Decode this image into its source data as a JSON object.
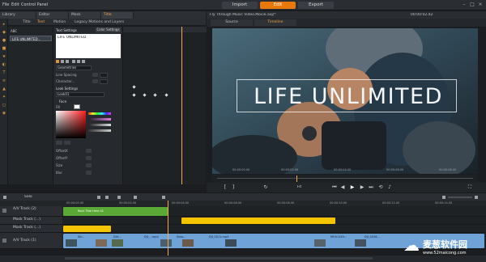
{
  "menu": {
    "items": [
      "File",
      "Edit",
      "Control Panel"
    ],
    "modes": [
      "Import",
      "Edit",
      "Export"
    ],
    "active_mode": "Edit"
  },
  "library_tabs": [
    "Library",
    "Editor",
    "Mask",
    "Title"
  ],
  "title_editor": {
    "subtabs": [
      "Title",
      "Text",
      "Motion",
      "Legacy Motions and Layers"
    ],
    "active_subtab": "Text",
    "layer_label": "LIFE UNLIMITED...",
    "text_settings_header": "Text Settings",
    "color_settings_label": "Color Settings",
    "text_value": "LIFE UNLIMITED",
    "geometry_label": "Geometries",
    "line_spacing_label": "Line Spacing",
    "character_label": "Character...",
    "look_settings_label": "Look Settings",
    "look_value": "Look01",
    "face_label": "Face",
    "fill_label": "Fill",
    "offset_x_label": "OffsetX",
    "offset_y_label": "OffsetY",
    "size_label": "Size",
    "blur_label": "Blur"
  },
  "preview": {
    "header_title": "Fly Through Music Video.Movie.axp*",
    "timecode": "00:00:02.42",
    "tabs": [
      "Source",
      "Timeline"
    ],
    "active_tab": "Timeline",
    "overlay_title": "LIFE UNLIMITED",
    "zoom_label": "Fit",
    "timecodes": [
      "00:00:00.00",
      "00:00:02.00",
      "00:00:04.00",
      "00:00:06.00",
      "00:00:08.00"
    ]
  },
  "timeline": {
    "solo_label": "Solo",
    "ruler": [
      "00:00:00.00",
      "00:00:02.00",
      "00:00:04.00",
      "00:00:06.00",
      "00:00:08.00",
      "00:00:10.00",
      "00:00:12.00",
      "00:00:14.00"
    ],
    "tracks": [
      {
        "name": "A/V Track (2)",
        "clip": "Rock Title Hero 01"
      },
      {
        "name": "Mask Track (...)"
      },
      {
        "name": "Mask Track (...)"
      },
      {
        "name": "A/V Track (1)",
        "clips": [
          "Ski...",
          "Dirt...",
          "DJI_...mp4",
          "Slow...",
          "DJI_0011.mp4",
          "MOV1163...",
          "DJI_0036..."
        ]
      }
    ]
  },
  "watermark": {
    "site_name": "麦葱软件园",
    "url": "www.52maicong.com"
  },
  "colors": {
    "accent": "#e8780b",
    "mask_clip": "#f5c400",
    "video_clip": "#6fa3d8",
    "title_clip": "#5aa836"
  }
}
